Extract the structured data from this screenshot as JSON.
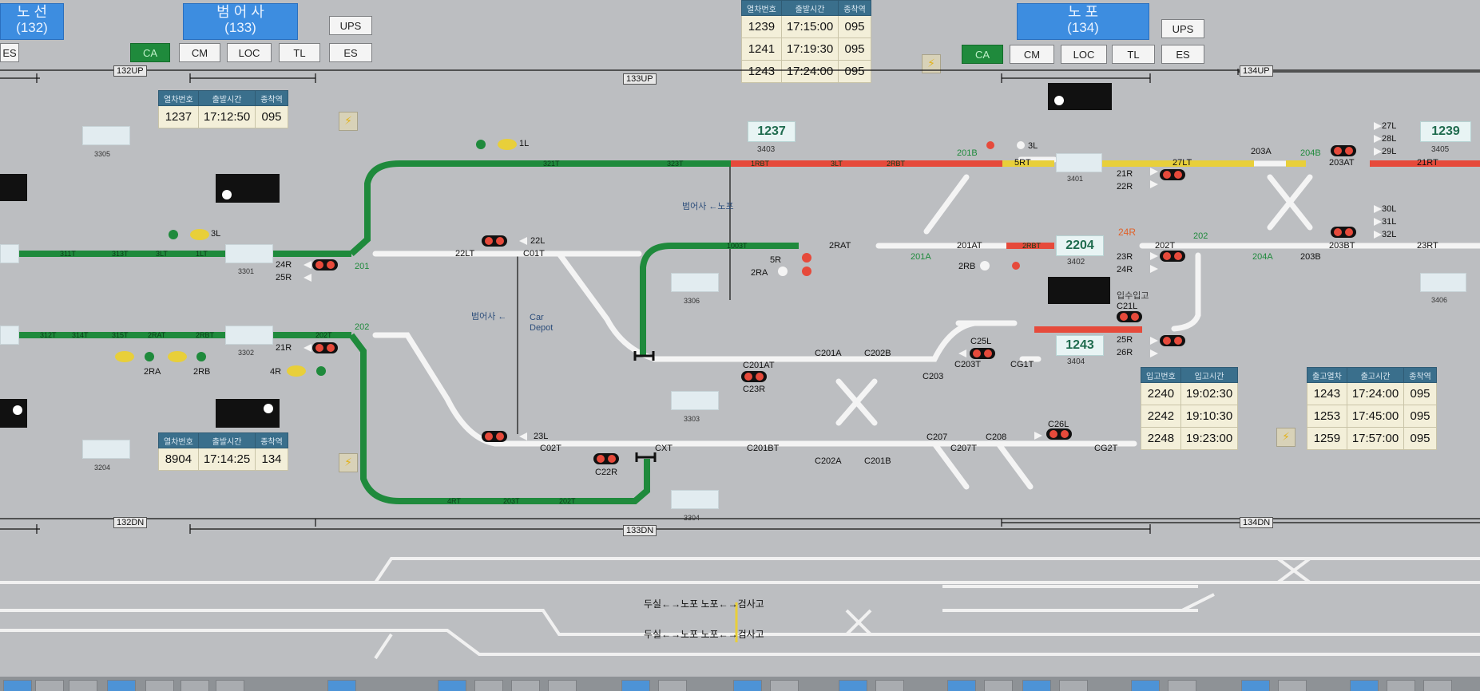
{
  "stations": [
    {
      "id": "left",
      "name_line1": "노 선",
      "name_line2": "(132)"
    },
    {
      "id": "center",
      "name_line1": "범 어 사",
      "name_line2": "(133)"
    },
    {
      "id": "right",
      "name_line1": "노 포",
      "name_line2": "(134)"
    }
  ],
  "controls": {
    "ups": "UPS",
    "es": "ES",
    "ca": "CA",
    "cm": "CM",
    "loc": "LOC",
    "tl": "TL"
  },
  "section_labels": {
    "up_132": "132UP",
    "up_133": "133UP",
    "up_134": "134UP",
    "dn_132": "132DN",
    "dn_133": "133DN",
    "dn_134": "134DN"
  },
  "top_schedule": {
    "headers": [
      "열차번호",
      "출발시간",
      "종착역"
    ],
    "rows": [
      [
        "1239",
        "17:15:00",
        "095"
      ],
      [
        "1241",
        "17:19:30",
        "095"
      ],
      [
        "1243",
        "17:24:00",
        "095"
      ]
    ]
  },
  "schedule_upper_left": {
    "headers": [
      "열차번호",
      "출발시간",
      "종착역"
    ],
    "rows": [
      [
        "1237",
        "17:12:50",
        "095"
      ]
    ]
  },
  "schedule_lower_left": {
    "headers": [
      "열차번호",
      "출발시간",
      "종착역"
    ],
    "rows": [
      [
        "8904",
        "17:14:25",
        "134"
      ]
    ]
  },
  "depot_in": {
    "headers": [
      "입고번호",
      "입고시간"
    ],
    "rows": [
      [
        "2240",
        "19:02:30"
      ],
      [
        "2242",
        "19:10:30"
      ],
      [
        "2248",
        "19:23:00"
      ]
    ]
  },
  "depot_out": {
    "headers": [
      "출고열차",
      "출고시간",
      "종착역"
    ],
    "rows": [
      [
        "1243",
        "17:24:00",
        "095"
      ],
      [
        "1253",
        "17:45:00",
        "095"
      ],
      [
        "1259",
        "17:57:00",
        "095"
      ]
    ]
  },
  "trains": {
    "t1237": "1237",
    "t1239": "1239",
    "t2204": "2204",
    "t1243": "1243"
  },
  "track_ids": {
    "b3305": "3305",
    "b3301": "3301",
    "b3302": "3302",
    "b3204": "3204",
    "b3306": "3306",
    "b3303": "3303",
    "b3304": "3304",
    "b3403": "3403",
    "b3401": "3401",
    "b3402": "3402",
    "b3404": "3404",
    "b3405": "3405",
    "b3406": "3406"
  },
  "signals": {
    "s1L": "1L",
    "s3L_top": "3L",
    "s3L_left": "3L",
    "s22L": "22L",
    "s22LT": "22LT",
    "sC01T": "C01T",
    "s24R": "24R",
    "s25R": "25R",
    "s21R_left": "21R",
    "s4R": "4R",
    "s2RA_left": "2RA",
    "s2RB_left": "2RB",
    "s23L": "23L",
    "sC02T": "C02T",
    "sCXT": "CXT",
    "sC22R": "C22R",
    "sC201BT": "C201BT",
    "s5R": "5R",
    "s2RA": "2RA",
    "s2RAT": "2RAT",
    "s201AT": "201AT",
    "s2RB": "2RB",
    "s202T": "202T",
    "sC201AT": "C201AT",
    "sC23R": "C23R",
    "sC201A": "C201A",
    "sC202B": "C202B",
    "sC203": "C203",
    "sC25L": "C25L",
    "sC203T": "C203T",
    "sCG1T": "CG1T",
    "sC21L": "C21L",
    "s25R_r": "25R",
    "s26R": "26R",
    "s21R_r": "21R",
    "s22R": "22R",
    "s23R": "23R",
    "s24R_r": "24R",
    "sC207": "C207",
    "sC207T": "C207T",
    "sC208": "C208",
    "sC26L": "C26L",
    "sCG2T": "CG2T",
    "sC202A": "C202A",
    "sC201B": "C201B",
    "s27L": "27L",
    "s28L": "28L",
    "s29L": "29L",
    "s30L": "30L",
    "s31L": "31L",
    "s32L": "32L",
    "s203A": "203A",
    "s203AT": "203AT",
    "s203BT": "203BT",
    "s203B": "203B",
    "s21RT": "21RT",
    "s23RT": "23RT",
    "s27LT": "27LT",
    "s5RT": "5RT"
  },
  "green_labels": {
    "g201": "201",
    "g202": "202",
    "g201A": "201A",
    "g204A": "204A",
    "g202r": "202",
    "g201B": "201B",
    "g204B": "204B"
  },
  "orange_labels": {
    "o24R": "24R"
  },
  "text_labels": {
    "dir_top": "범어사 ←노포",
    "dir_mid": "범어사 ←",
    "car_depot": "Car\nDepot",
    "depot_kr": "입수입고",
    "bottom_line1": "두실←→노포  노포←→검사고",
    "bottom_line2": "두실←→노포  노포←→검사고"
  },
  "colors": {
    "occupied": "#1f8a3c",
    "route": "#e64a3b",
    "caution": "#e8cf3a",
    "free": "#f2f2f2",
    "station": "#3d8de0"
  },
  "icons": {
    "lightning": "⚡"
  }
}
